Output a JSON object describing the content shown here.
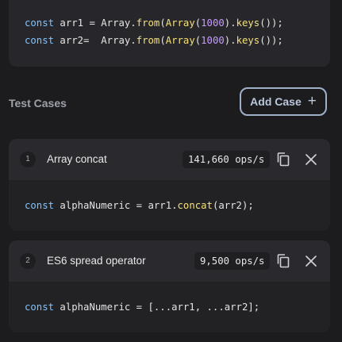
{
  "setup": {
    "line1": {
      "kw": "const",
      "rest_a": " arr1 = Array.",
      "fn1": "from",
      "p1": "(",
      "fn2": "Array",
      "p2": "(",
      "num": "1000",
      "p3": ").",
      "fn3": "keys",
      "p4": "());"
    },
    "line2": {
      "kw": "const",
      "rest_a": " arr2=  Array.",
      "fn1": "from",
      "p1": "(",
      "fn2": "Array",
      "p2": "(",
      "num": "1000",
      "p3": ").",
      "fn3": "keys",
      "p4": "());"
    }
  },
  "section_title": "Test Cases",
  "add_case_label": "Add Case",
  "add_case_icon": "+",
  "cases": [
    {
      "index": "1",
      "name": "Array concat",
      "ops": "141,660 ops/s",
      "code": {
        "kw": "const",
        "a": " alphaNumeric = arr1.",
        "fn": "concat",
        "b": "(arr2);"
      }
    },
    {
      "index": "2",
      "name": "ES6 spread operator",
      "ops": "9,500 ops/s",
      "code": {
        "kw": "const",
        "a": " alphaNumeric = [...arr1, ...arr2];"
      }
    }
  ],
  "icons": {
    "copy": "copy-icon",
    "close": "close-icon"
  },
  "colors": {
    "background": "#1c1c1f",
    "panel": "#2a2a2e",
    "keyword": "#7ec3ff",
    "function": "#f5e07a",
    "number": "#c79bff",
    "button_border": "#9fb1c8"
  }
}
